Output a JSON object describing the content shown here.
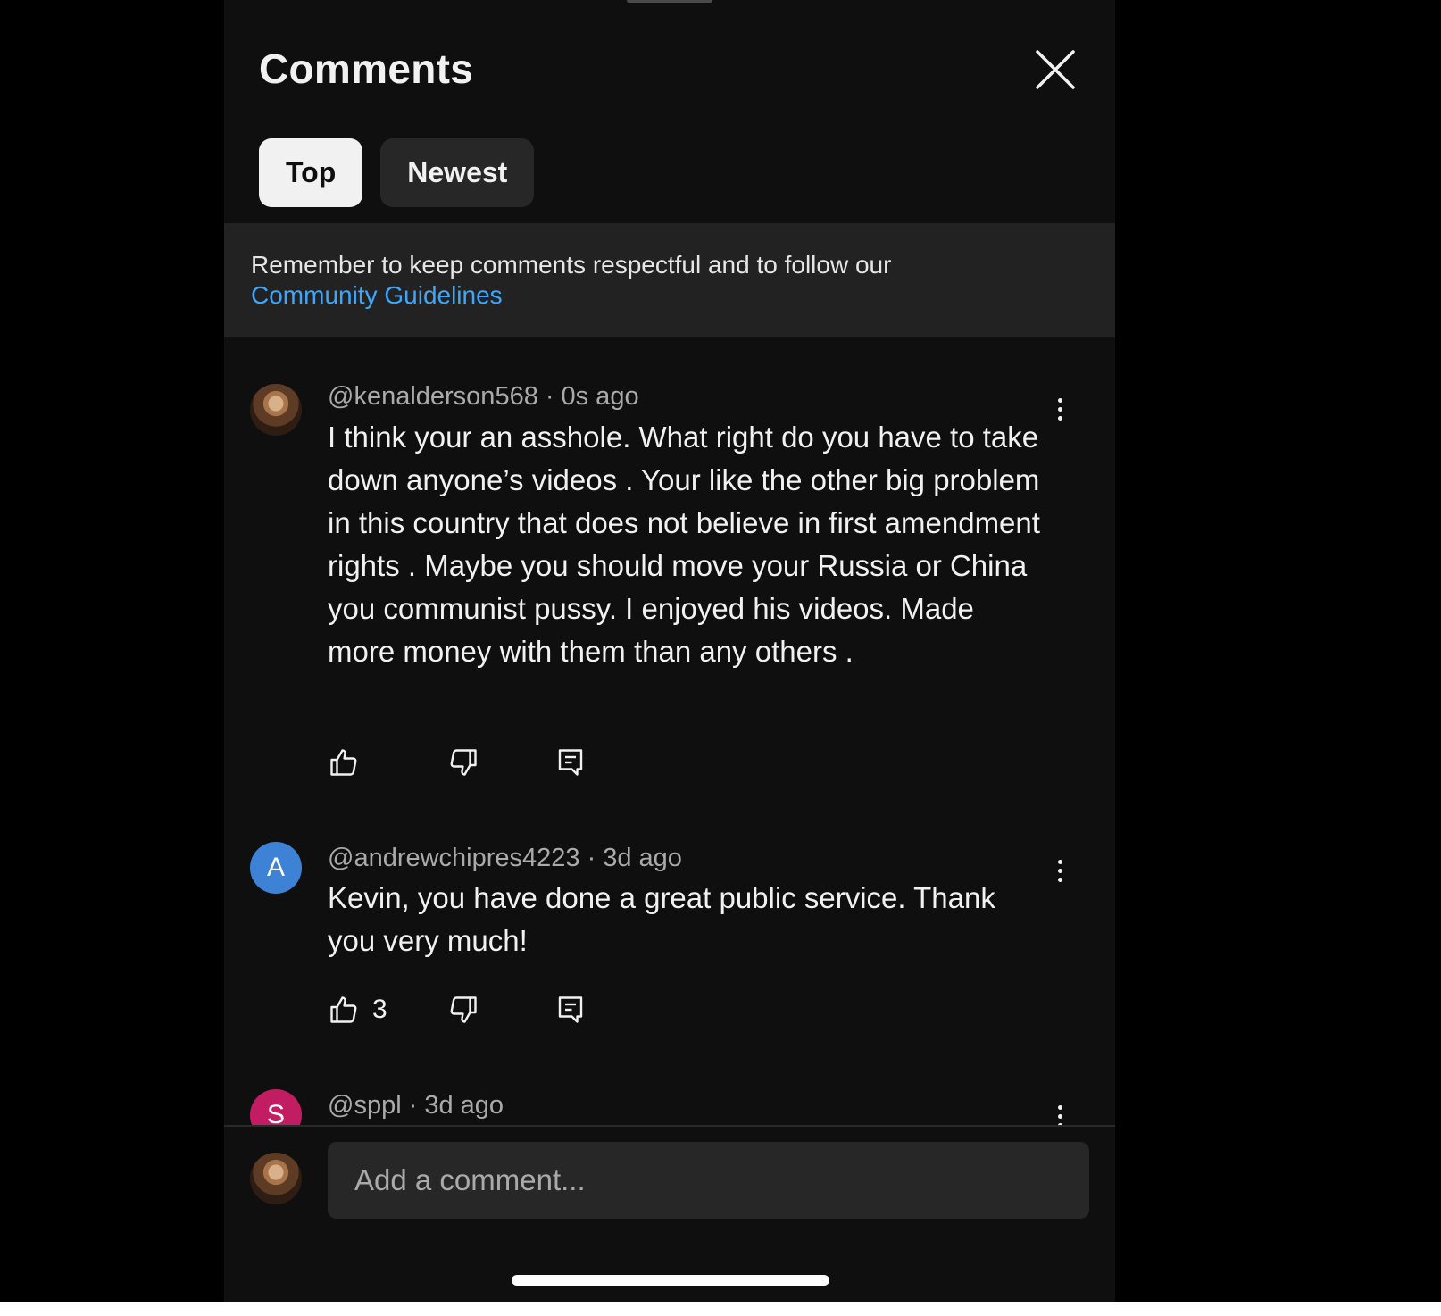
{
  "header": {
    "title": "Comments",
    "close_icon": "close-icon"
  },
  "tabs": [
    {
      "label": "Top",
      "selected": true
    },
    {
      "label": "Newest",
      "selected": false
    }
  ],
  "notice": {
    "text": "Remember to keep comments respectful and to follow our",
    "link": "Community Guidelines"
  },
  "comments": [
    {
      "author": "@kenalderson568",
      "time": "0s ago",
      "avatar_letter": "",
      "text": "I think your an asshole. What right do you have to take down anyone’s videos . Your like the other big problem in this country that does not believe in first amendment rights . Maybe you should move your Russia or China you communist  pussy. I enjoyed his videos. Made more money with them than any others .",
      "likes": ""
    },
    {
      "author": "@andrewchipres4223",
      "time": "3d ago",
      "avatar_letter": "A",
      "text": "Kevin, you have done a great public service. Thank you very much!",
      "likes": "3"
    },
    {
      "author": "@sppl",
      "time": "3d ago",
      "avatar_letter": "S",
      "text": "",
      "likes": ""
    }
  ],
  "compose": {
    "placeholder": "Add a comment..."
  },
  "colors": {
    "background": "#0f0f0f",
    "text": "#f1f1f1",
    "secondary_text": "#aaaaaa",
    "link": "#3ea6ff",
    "chip_active": "#f1f1f1",
    "chip_inactive": "#272727",
    "avatar_a": "#3e82d6",
    "avatar_s": "#c21d62"
  },
  "icons": [
    "close-icon",
    "kebab-menu-icon",
    "thumbs-up-icon",
    "thumbs-down-icon",
    "reply-icon"
  ]
}
